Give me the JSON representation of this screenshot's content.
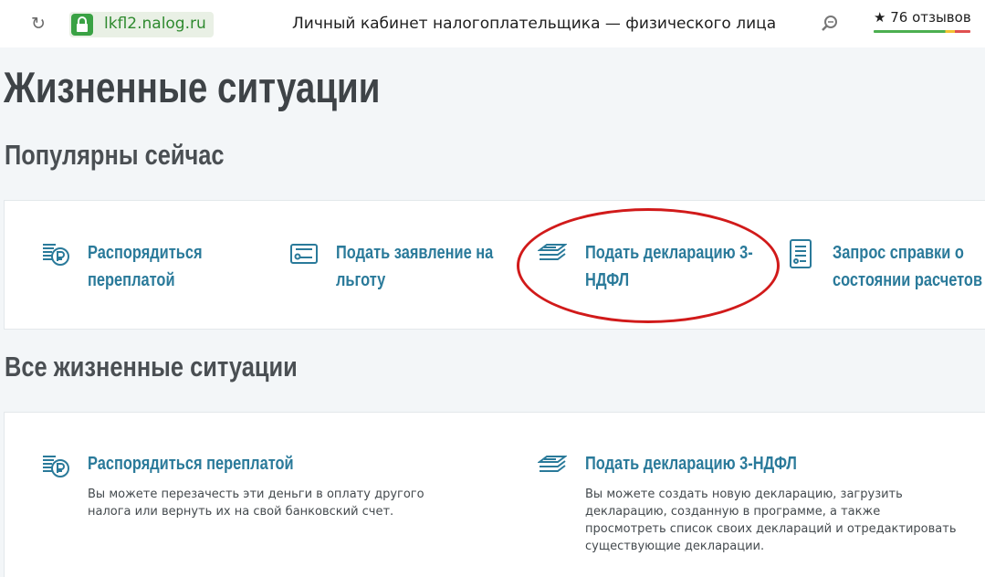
{
  "browser": {
    "url": "lkfl2.nalog.ru",
    "title": "Личный кабинет налогоплательщика — физического лица",
    "reviews": "★ 76 отзывов",
    "reviews_rating": 0.74
  },
  "page": {
    "title": "Жизненные ситуации",
    "popular_heading": "Популярны сейчас",
    "all_heading": "Все жизненные ситуации"
  },
  "popular": [
    {
      "title_line1": "Распорядиться",
      "title_line2": "переплатой",
      "icon": "coins-ruble-icon"
    },
    {
      "title_line1": "Подать заявление на",
      "title_line2": "льготу",
      "icon": "certificate-icon"
    },
    {
      "title_line1": "Подать декларацию 3-",
      "title_line2": "НДФЛ",
      "icon": "documents-stack-icon"
    },
    {
      "title_line1": "Запрос справки о",
      "title_line2": "состоянии расчетов",
      "icon": "document-list-icon"
    }
  ],
  "all": [
    {
      "title": "Распорядиться переплатой",
      "icon": "coins-ruble-icon",
      "desc": [
        "Вы можете перезачесть эти деньги в оплату другого",
        "налога или вернуть их на свой банковский счет."
      ]
    },
    {
      "title": "Подать декларацию 3-НДФЛ",
      "icon": "documents-stack-icon",
      "desc": [
        "Вы можете создать новую декларацию, загрузить",
        "декларацию, созданную в программе, а также",
        "просмотреть список своих деклараций и отредактировать",
        "существующие декларации."
      ]
    }
  ],
  "colors": {
    "accent": "#2a7a9a",
    "highlight": "#d11a1a",
    "secure": "#3aa244"
  }
}
